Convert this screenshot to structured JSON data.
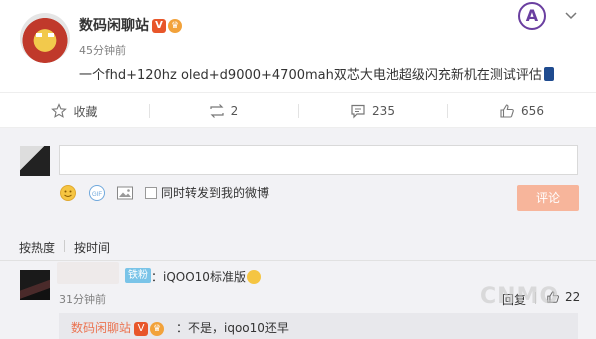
{
  "post": {
    "author": "数码闲聊站",
    "verified_badge": "V",
    "time": "45分钟前",
    "content": "一个fhd+120hz oled+d9000+4700mah双芯大电池超级闪充新机在测试评估"
  },
  "actions": {
    "favorite_label": "收藏",
    "repost_count": "2",
    "comment_count": "235",
    "like_count": "656"
  },
  "composer": {
    "repost_label": "同时转发到我的微博",
    "submit_label": "评论"
  },
  "sort": {
    "by_hot": "按热度",
    "by_time": "按时间"
  },
  "comment": {
    "fan_badge": "铁粉",
    "text": "：iQOO10标准版",
    "time": "31分钟前",
    "reply_label": "回复",
    "like_count": "22"
  },
  "sub_reply": {
    "author": "数码闲聊站",
    "text": "：不是，iqoo10还早"
  },
  "watermark": "CNMO",
  "colors": {
    "accent": "#eb7350",
    "submit_bg": "#f7b59b",
    "fan_badge": "#7ac4e8",
    "comment_bg": "#f2f2f5"
  }
}
